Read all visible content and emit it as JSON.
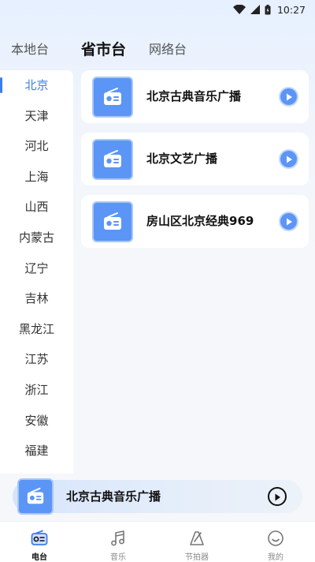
{
  "status_bar": {
    "time": "10:27"
  },
  "top_tabs": [
    {
      "label": "本地台"
    },
    {
      "label": "省市台"
    },
    {
      "label": "网络台"
    }
  ],
  "active_tab": "省市台",
  "sidebar": {
    "items": [
      {
        "label": "北京"
      },
      {
        "label": "天津"
      },
      {
        "label": "河北"
      },
      {
        "label": "上海"
      },
      {
        "label": "山西"
      },
      {
        "label": "内蒙古"
      },
      {
        "label": "辽宁"
      },
      {
        "label": "吉林"
      },
      {
        "label": "黑龙江"
      },
      {
        "label": "江苏"
      },
      {
        "label": "浙江"
      },
      {
        "label": "安徽"
      },
      {
        "label": "福建"
      }
    ],
    "active": "北京"
  },
  "stations": [
    {
      "name": "北京古典音乐广播"
    },
    {
      "name": "北京文艺广播"
    },
    {
      "name": "房山区北京经典969"
    }
  ],
  "mini_player": {
    "title": "北京古典音乐广播"
  },
  "bottom_nav": {
    "items": [
      {
        "label": "电台",
        "icon": "radio-icon"
      },
      {
        "label": "音乐",
        "icon": "music-note-icon"
      },
      {
        "label": "节拍器",
        "icon": "metronome-icon"
      },
      {
        "label": "我的",
        "icon": "smiley-icon"
      }
    ],
    "active": "电台"
  },
  "colors": {
    "accent": "#3d7cf0",
    "thumb": "#5b95f5",
    "card": "#ffffff",
    "background": "#f5f7fa"
  }
}
